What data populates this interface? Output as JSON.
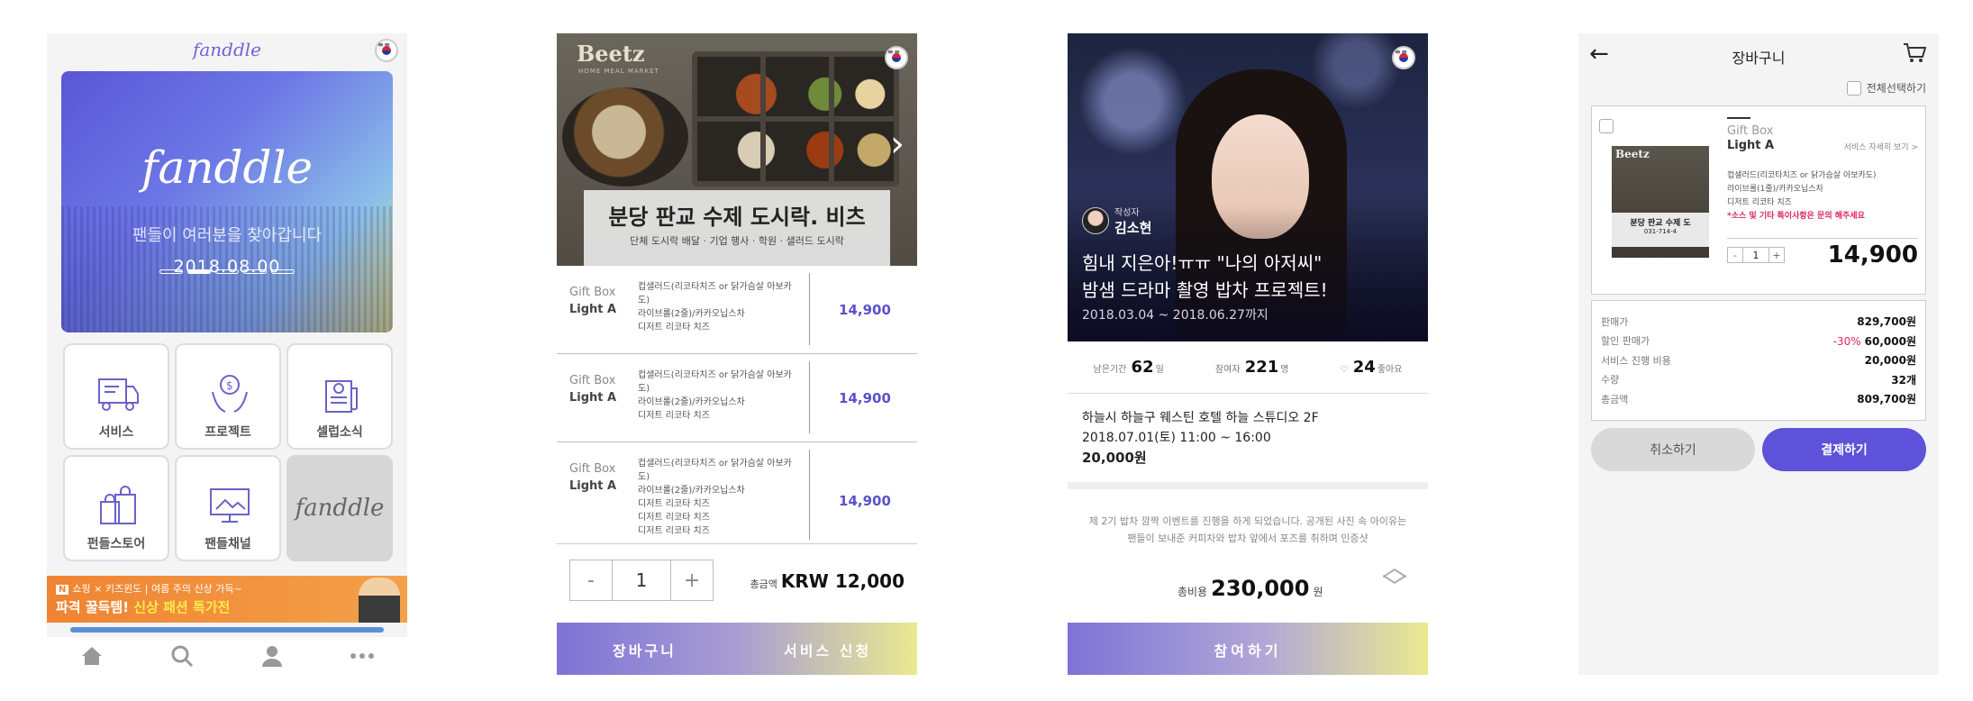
{
  "screen1": {
    "logo": "fanddle",
    "banner": {
      "logo": "fanddle",
      "tagline": "팬들이 여러분을 찾아갑니다",
      "date": "2018.08.00"
    },
    "tiles": [
      {
        "label": "서비스",
        "icon": "delivery-truck-icon"
      },
      {
        "label": "프로젝트",
        "icon": "money-hands-icon"
      },
      {
        "label": "셀럽소식",
        "icon": "newspaper-icon"
      },
      {
        "label": "펀들스토어",
        "icon": "shopping-bags-icon"
      },
      {
        "label": "팬들채널",
        "icon": "monitor-icon"
      },
      {
        "label": "fanddle",
        "icon": "fanddle-logo"
      }
    ],
    "ad": {
      "badge": "N",
      "line1": "쇼핑 × 키즈윈도 | 여름 주의 신상 가득~",
      "line2_a": "파격 꿀득템! ",
      "line2_b": "신상 패션 특가전"
    },
    "nav": [
      "home-icon",
      "search-icon",
      "person-icon",
      "more-icon"
    ]
  },
  "screen2": {
    "brand": "Beetz",
    "brand_sub": "HOME MEAL MARKET",
    "sign_title": "분당 판교 수제 도시락. 비츠",
    "sign_sub": "단체 도시락 배달 · 기업 행사 · 학원 · 샐러드 도시락",
    "rows": [
      {
        "tag": "Gift Box",
        "name": "Light A",
        "desc": [
          "컵샐러드(리코타치즈 or 닭가슴살 아보카도)",
          "라이브롤(2줄)/카카오닙스차",
          "디저트 리코타 치즈"
        ],
        "price": "14,900"
      },
      {
        "tag": "Gift Box",
        "name": "Light A",
        "desc": [
          "컵샐러드(리코타치즈 or 닭가슴살 아보카도)",
          "라이브롤(2줄)/카카오닙스차",
          "디저트 리코타 치즈"
        ],
        "price": "14,900"
      },
      {
        "tag": "Gift Box",
        "name": "Light A",
        "desc": [
          "컵샐러드(리코타치즈 or 닭가슴살 아보카도)",
          "라이브롤(2줄)/카카오닙스차",
          "디저트 리코타 치즈",
          "디저트 리코타 치즈",
          "디저트 리코타 치즈"
        ],
        "price": "14,900"
      }
    ],
    "qty": {
      "minus": "-",
      "value": "1",
      "plus": "+"
    },
    "total_label": "총금액",
    "total_value": "KRW 12,000",
    "cart_button": "장바구니",
    "order_button": "서비스 신청"
  },
  "screen3": {
    "author_label": "작성자",
    "author_name": "김소현",
    "title_line1": "힘내 지은아!ㅠㅠ \"나의 아저씨\"",
    "title_line2": "밤샘 드라마 촬영 밥차 프로젝트!",
    "period": "2018.03.04 ~ 2018.06.27까지",
    "stats": [
      {
        "label": "남은기간",
        "value": "62",
        "unit": "일"
      },
      {
        "label": "참여자",
        "value": "221",
        "unit": "명"
      },
      {
        "label": "♡",
        "value": "24",
        "unit": "좋아요"
      }
    ],
    "venue": "하늘시 하늘구 웨스틴 호텔 하늘 스튜디오 2F",
    "datetime": "2018.07.01(토) 11:00 ~ 16:00",
    "fee": "20,000원",
    "body": "제 2기 밥차 깜짝 이벤트를 진행을 하게 되었습니다. 공개된 사진 속 아이유는 팬들이 보내준 커피차와 밥차 앞에서 포즈를 취하며 인증샷",
    "total_label": "총비용",
    "total_value": "230,000",
    "total_unit": "원",
    "join_button": "참여하기"
  },
  "screen4": {
    "title": "장바구니",
    "select_all": "전체선택하기",
    "item": {
      "tag": "Gift Box",
      "name": "Light A",
      "detail_link": "서비스 자세히 보기 >",
      "desc": [
        "컵샐러드(리코타치즈 or 닭가슴살 아보카도)",
        "라이브롤(1줄)/카카오닙스차",
        "디저트 리코타 치즈"
      ],
      "note": "*소스 및 기타 특이사항은 문의 해주세요",
      "thumb_sign": "분당 판교 수제 도",
      "thumb_phone": "031-714-4",
      "qty": "1",
      "price": "14,900"
    },
    "summary": [
      {
        "label": "판매가",
        "value": "829,700원",
        "discount": ""
      },
      {
        "label": "할인 판매가",
        "value": "60,000원",
        "discount": "-30%"
      },
      {
        "label": "서비스 진행 비용",
        "value": "20,000원",
        "discount": ""
      },
      {
        "label": "수량",
        "value": "32개",
        "discount": ""
      },
      {
        "label": "총금액",
        "value": "809,700원",
        "discount": ""
      }
    ],
    "cancel_button": "취소하기",
    "pay_button": "결제하기"
  },
  "colors": {
    "accent": "#5d52d9",
    "price": "#5a52cc",
    "alert": "#e0245e",
    "ad": "#ef8432"
  }
}
